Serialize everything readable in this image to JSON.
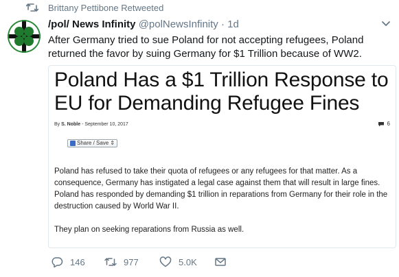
{
  "retweet": {
    "label": "Brittany Pettibone Retweeted"
  },
  "tweet": {
    "display_name": "/pol/ News Infinity",
    "handle": "@polNewsInfinity",
    "separator": "·",
    "timestamp": "1d",
    "text": "After Germany tried to sue Poland for not accepting refugees, Poland returned the favor by suing Germany for $1 Trillion because of WW2."
  },
  "card": {
    "title": "Poland Has a $1 Trillion Response to EU for Demanding Refugee Fines",
    "byline_prefix": "By",
    "author": "S. Noble",
    "date": "- September 10, 2017",
    "comments": "6",
    "share_label": "Share / Save",
    "share_caret": "⇕",
    "paragraphs": [
      "Poland has refused to take their quota of refugees or any refugees for that matter. As a consequence, Germany has instigated a legal case against them that will result in large fines. Poland has responded by demanding $1 trillion in reparations from Germany for their role in the destruction caused by World War II.",
      "They plan on seeking reparations from Russia as well."
    ]
  },
  "actions": {
    "replies": "146",
    "retweets": "977",
    "likes": "5.0K"
  },
  "colors": {
    "secondary_text": "#657786",
    "border": "#e1e8ed",
    "avatar_green": "#1f7a2e"
  }
}
